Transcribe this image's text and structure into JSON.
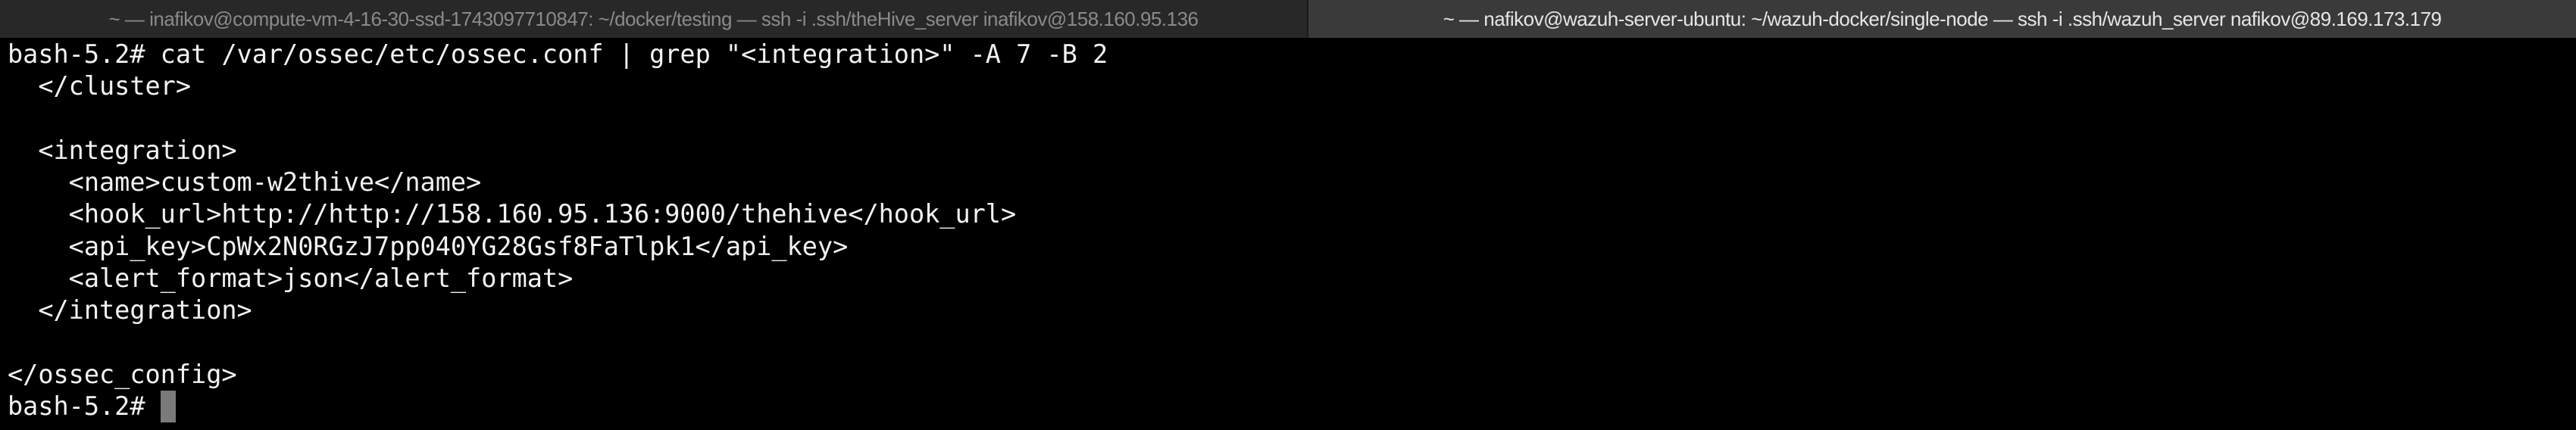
{
  "tabs": [
    {
      "title": "~ — inafikov@compute-vm-4-16-30-ssd-1743097710847: ~/docker/testing — ssh -i .ssh/theHive_server inafikov@158.160.95.136",
      "active": false
    },
    {
      "title": "~ — nafikov@wazuh-server-ubuntu: ~/wazuh-docker/single-node — ssh -i .ssh/wazuh_server nafikov@89.169.173.179",
      "active": true
    }
  ],
  "terminal": {
    "lines": [
      "bash-5.2# cat /var/ossec/etc/ossec.conf | grep \"<integration>\" -A 7 -B 2",
      "  </cluster>",
      "",
      "  <integration>",
      "    <name>custom-w2thive</name>",
      "    <hook_url>http://http://158.160.95.136:9000/thehive</hook_url>",
      "    <api_key>CpWx2N0RGzJ7pp040YG28Gsf8FaTlpk1</api_key>",
      "    <alert_format>json</alert_format>",
      "  </integration>",
      "",
      "</ossec_config>"
    ],
    "prompt": "bash-5.2# "
  }
}
